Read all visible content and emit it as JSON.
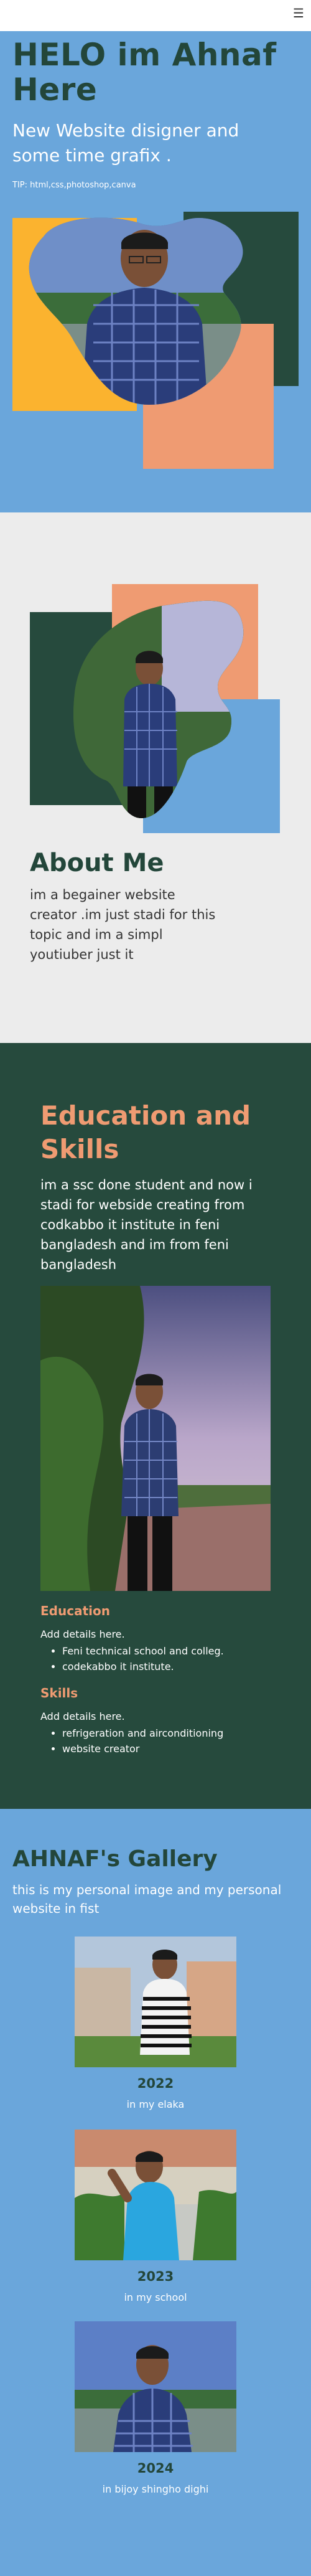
{
  "header": {
    "menu_icon": "hamburger-menu-icon"
  },
  "hero": {
    "title": "HELO im Ahnaf Here",
    "subtitle": "New Website disigner and some time grafix .",
    "tip": "TIP: html,css,photoshop,canva"
  },
  "about": {
    "title": "About Me",
    "text": "im a begainer website creator .im just stadi for this topic and im a simpl youtiuber just it"
  },
  "education": {
    "title": "Education and Skills",
    "text": "im a ssc done student and now i stadi for webside creating from codkabbo it institute in feni bangladesh and im from feni bangladesh",
    "education_heading": "Education",
    "education_add": "Add details here.",
    "education_items": [
      "Feni technical school and colleg.",
      "codekabbo it institute."
    ],
    "skills_heading": "Skills",
    "skills_add": "Add details here.",
    "skills_items": [
      "refrigeration and airconditioning",
      "website creator"
    ]
  },
  "gallery": {
    "title": "AHNAF's Gallery",
    "subtitle": "this is my personal image and my personal website in fist",
    "items": [
      {
        "year": "2022",
        "caption": "in my elaka"
      },
      {
        "year": "2023",
        "caption": "in my school"
      },
      {
        "year": "2024",
        "caption": "in bijoy shingho dighi"
      }
    ]
  },
  "colors": {
    "blue": "#6aa6db",
    "dark_green": "#264a3d",
    "orange": "#ef9b72",
    "yellow": "#fbb32f",
    "light_gray": "#ececec"
  }
}
